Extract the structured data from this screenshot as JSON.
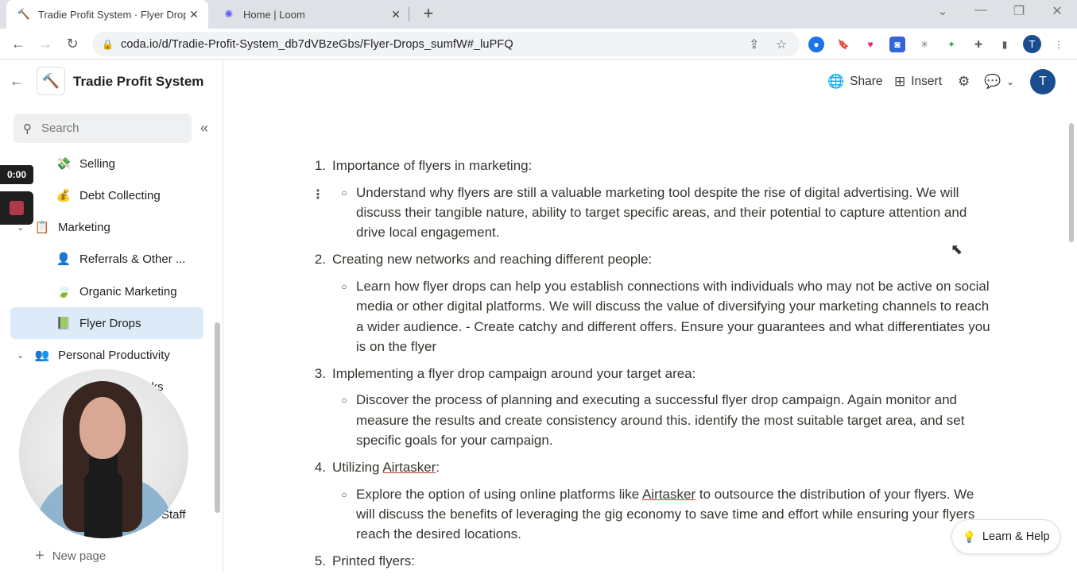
{
  "browser": {
    "tabs": [
      {
        "title": "Tradie Profit System · Flyer Drops",
        "icon": "hammer-icon",
        "active": true
      },
      {
        "title": "Home | Loom",
        "icon": "loom-icon",
        "active": false
      }
    ],
    "url": "coda.io/d/Tradie-Profit-System_db7dVBzeGbs/Flyer-Drops_sumfW#_luPFQ",
    "profile_initial": "T"
  },
  "sidebar": {
    "doc_title": "Tradie Profit System",
    "search_placeholder": "Search",
    "items": [
      {
        "label": "Selling",
        "icon": "money-icon"
      },
      {
        "label": "Debt Collecting",
        "icon": "person-coins-icon"
      },
      {
        "label": "Marketing",
        "icon": "clipboard-icon"
      },
      {
        "label": "Referrals & Other ...",
        "icon": "person-icon"
      },
      {
        "label": "Organic Marketing",
        "icon": "leaf-icon"
      },
      {
        "label": "Flyer Drops",
        "icon": "flyer-icon"
      },
      {
        "label": "Personal Productivity",
        "icon": "people-icon"
      }
    ],
    "partial_items": [
      "sks",
      "Staff"
    ],
    "new_page": "New page"
  },
  "loom": {
    "timer": "0:00"
  },
  "toolbar": {
    "share": "Share",
    "insert": "Insert",
    "avatar_initial": "T"
  },
  "content": {
    "sections": [
      {
        "num": "1.",
        "heading": "Importance of flyers in marketing:",
        "body": "Understand why flyers are still a valuable marketing tool despite the rise of digital advertising. We will discuss their tangible nature, ability to target specific areas, and their potential to capture attention and drive local engagement."
      },
      {
        "num": "2.",
        "heading": "Creating new networks and reaching different people:",
        "body": "Learn how flyer drops can help you establish connections with individuals who may not be active on social media or other digital platforms. We will discuss the value of diversifying your marketing channels to reach a wider audience. - Create catchy and different offers. Ensure your guarantees and what differentiates you is on the flyer"
      },
      {
        "num": "3.",
        "heading": "Implementing a flyer drop campaign around your target area:",
        "body": "Discover the process of planning and executing a successful flyer drop campaign. Again monitor and measure the results and create consistency around this. identify the most suitable target area,  and set specific goals for your campaign."
      },
      {
        "num": "4.",
        "heading_pre": "Utilizing ",
        "heading_link": "Airtasker",
        "heading_post": ":",
        "body_pre": "Explore the option of using online platforms like ",
        "body_link": "Airtasker",
        "body_post": " to outsource the distribution of your flyers. We will discuss the benefits of leveraging the gig economy to save time and effort while ensuring your flyers reach the desired locations."
      },
      {
        "num": "5.",
        "heading": "Printed flyers:"
      }
    ]
  },
  "help_button": "Learn & Help"
}
